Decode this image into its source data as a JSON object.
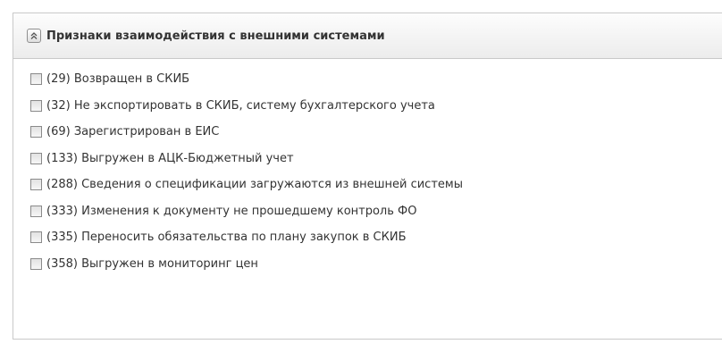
{
  "panel": {
    "title": "Признаки взаимодействия с внешними системами",
    "collapse_icon": "double-chevron-up-icon",
    "items": [
      {
        "label": "(29) Возвращен в СКИБ",
        "checked": false
      },
      {
        "label": "(32) Не экспортировать в СКИБ, систему бухгалтерского учета",
        "checked": false
      },
      {
        "label": "(69) Зарегистрирован в ЕИС",
        "checked": false
      },
      {
        "label": "(133) Выгружен в АЦК-Бюджетный учет",
        "checked": false
      },
      {
        "label": "(288) Сведения о спецификации загружаются из внешней системы",
        "checked": false
      },
      {
        "label": "(333) Изменения к документу не прошедшему контроль ФО",
        "checked": false
      },
      {
        "label": "(335) Переносить обязательства по плану закупок в СКИБ",
        "checked": false
      },
      {
        "label": "(358) Выгружен в мониторинг цен",
        "checked": false
      }
    ]
  }
}
